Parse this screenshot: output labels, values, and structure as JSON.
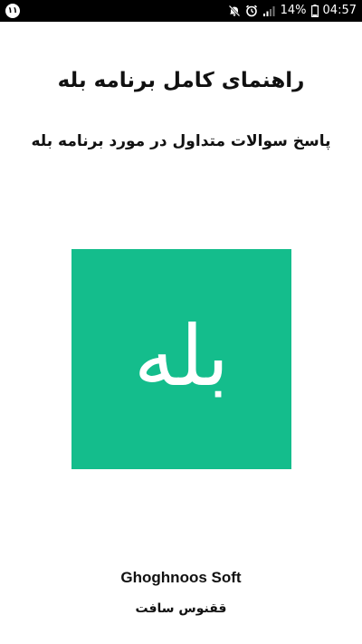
{
  "status_bar": {
    "notification_badge": "۱۱",
    "battery_percent": "14%",
    "time": "04:57",
    "icons": [
      "notification-badge-icon",
      "mute-icon",
      "alarm-icon",
      "signal-icon",
      "battery-icon"
    ]
  },
  "main": {
    "title": "راهنمای کامل برنامه بله",
    "subtitle": "پاسخ سوالات متداول در مورد برنامه بله",
    "logo_text": "بله",
    "logo_color": "#14bd8c"
  },
  "footer": {
    "company_en": "Ghoghnoos Soft",
    "company_fa": "ققنوس سافت"
  }
}
